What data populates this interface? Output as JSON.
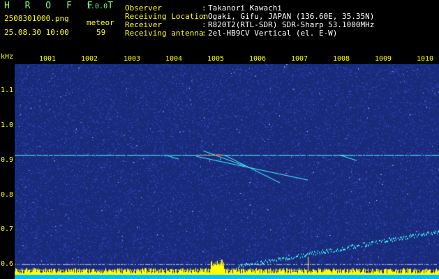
{
  "header": {
    "app_name": "H R O F F T",
    "version": "1.0.0",
    "filename": "2508301000.png",
    "datetime": "25.08.30 10:00",
    "meteor_label": "meteor",
    "meteor_count": "59"
  },
  "info": [
    {
      "label": "Observer",
      "sep": ":",
      "value": "Takanori Kawachi"
    },
    {
      "label": "Receiving Location",
      "sep": ":",
      "value": "Ogaki, Gifu, JAPAN (136.60E, 35.35N)"
    },
    {
      "label": "Receiver",
      "sep": ":",
      "value": "R820T2(RTL-SDR) SDR-Sharp 53.1000MHz"
    },
    {
      "label": "Receiving antenna",
      "sep": ":",
      "value": "2el-HB9CV Vertical (el. E-W)"
    }
  ],
  "chart_data": {
    "type": "heatmap",
    "ylabel": "kHz",
    "y_ticks": [
      "1.1",
      "1.0",
      "0.9",
      "0.8",
      "0.7",
      "0.6"
    ],
    "x_ticks": [
      "1001",
      "1002",
      "1003",
      "1004",
      "1005",
      "1006",
      "1007",
      "1008",
      "1009",
      "1010"
    ],
    "ylim": [
      0.58,
      1.16
    ],
    "colors": {
      "background": "#1a2a7a",
      "noise": "#3b6cff",
      "signal": "#40ffff",
      "hot": "#ff6020",
      "bar": "#ffff00",
      "base": "#00c0ff"
    }
  }
}
